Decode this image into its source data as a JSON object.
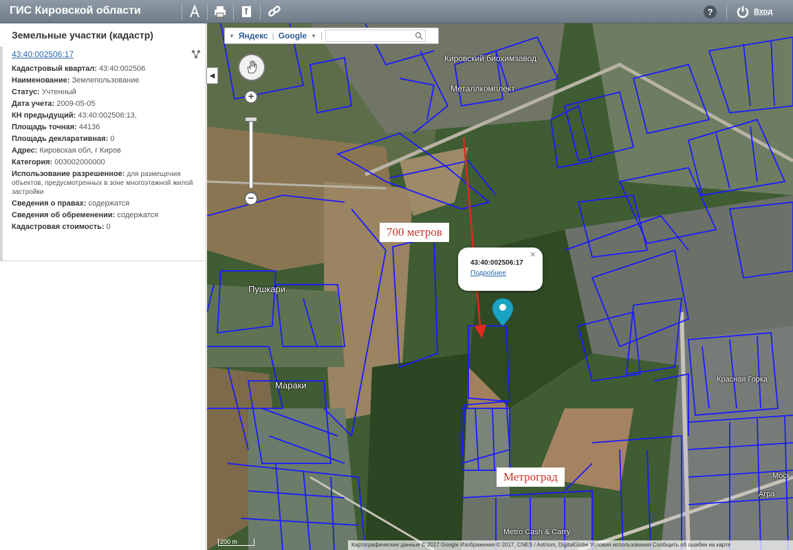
{
  "app": {
    "title": "ГИС Кировской области",
    "login_label": "Вход",
    "help_label": "?"
  },
  "toolbar": {
    "icons": [
      "measure-icon",
      "print-icon",
      "info-icon",
      "link-icon"
    ]
  },
  "panel": {
    "title": "Земельные участки (кадастр)",
    "parcel_link": "43:40:002506:17",
    "attributes": [
      {
        "label": "Кадастровый квартал:",
        "value": "43:40:002506"
      },
      {
        "label": "Наименование:",
        "value": "Землепользование"
      },
      {
        "label": "Статус:",
        "value": "Учтенный"
      },
      {
        "label": "Дата учета:",
        "value": "2009-05-05"
      },
      {
        "label": "КН предыдущий:",
        "value": "43:40:002506:13,"
      },
      {
        "label": "Площадь точная:",
        "value": "44136"
      },
      {
        "label": "Площадь декларативная:",
        "value": "0"
      },
      {
        "label": "Адрес:",
        "value": "Кировская обл, г Киров"
      },
      {
        "label": "Категория:",
        "value": "003002000000"
      },
      {
        "label": "Использование разрешенное:",
        "value": "для размещения объектов, предусмотренных в зоне многоэтажной жилой застройки"
      },
      {
        "label": "Сведения о правах:",
        "value": "содержатся"
      },
      {
        "label": "Сведения об обременении:",
        "value": "содержатся"
      },
      {
        "label": "Кадастровая стоимость:",
        "value": "0"
      }
    ]
  },
  "map": {
    "providers": {
      "yandex": "Яндекс",
      "google": "Google"
    },
    "search_placeholder": "",
    "labels": {
      "biokhim": "Кировский биохимзавод",
      "metall": "Металлкомплект",
      "pushkari": "Пушкари",
      "maraki": "Мараки",
      "krasnaya_gorka": "Красная Горка",
      "metro": "Metro Cash & Carry",
      "agra": "Агра",
      "mosk": "Моск"
    },
    "annotations": {
      "distance": "700 метров",
      "metrograd": "Метроград"
    },
    "popup": {
      "title": "43:40:002506:17",
      "link": "Подробнее"
    },
    "scale": "200 m",
    "copyright": "Картографические данные © 2017 Google Изображения © 2017, CNES / Astrium, DigitalGlobe   Условия использования   Сообщить об ошибке на карте"
  },
  "colors": {
    "parcel": "#1a1aff",
    "annotation": "#c8332b",
    "topbar": "#7d8a96",
    "link": "#2b6aa8",
    "marker": "#1ba3c4"
  }
}
